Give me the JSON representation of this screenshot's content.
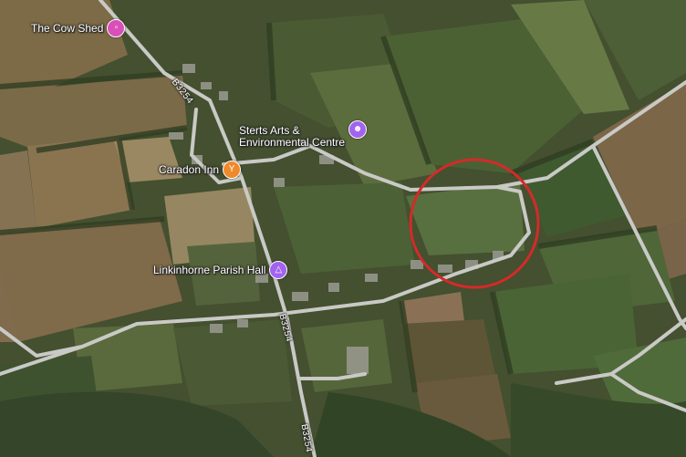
{
  "map": {
    "accent_color": "#d42a2a",
    "road_color": "#c8c8c8",
    "places": [
      {
        "name": "The Cow Shed",
        "icon": "bed-icon",
        "color": "#d94fb8"
      },
      {
        "name_line1": "Sterts Arts &",
        "name_line2": "Environmental Centre",
        "icon": "theatre-icon",
        "color": "#a163f0"
      },
      {
        "name": "Caradon Inn",
        "icon": "cocktail-icon",
        "color": "#ef8a2b"
      },
      {
        "name": "Linkinhorne Parish Hall",
        "icon": "hall-icon",
        "color": "#a163f0"
      }
    ],
    "roads": [
      {
        "label": "B3254"
      },
      {
        "label": "B3254"
      },
      {
        "label": "B3254"
      }
    ],
    "highlight": {
      "shape": "circle",
      "color": "#d42a2a"
    }
  }
}
